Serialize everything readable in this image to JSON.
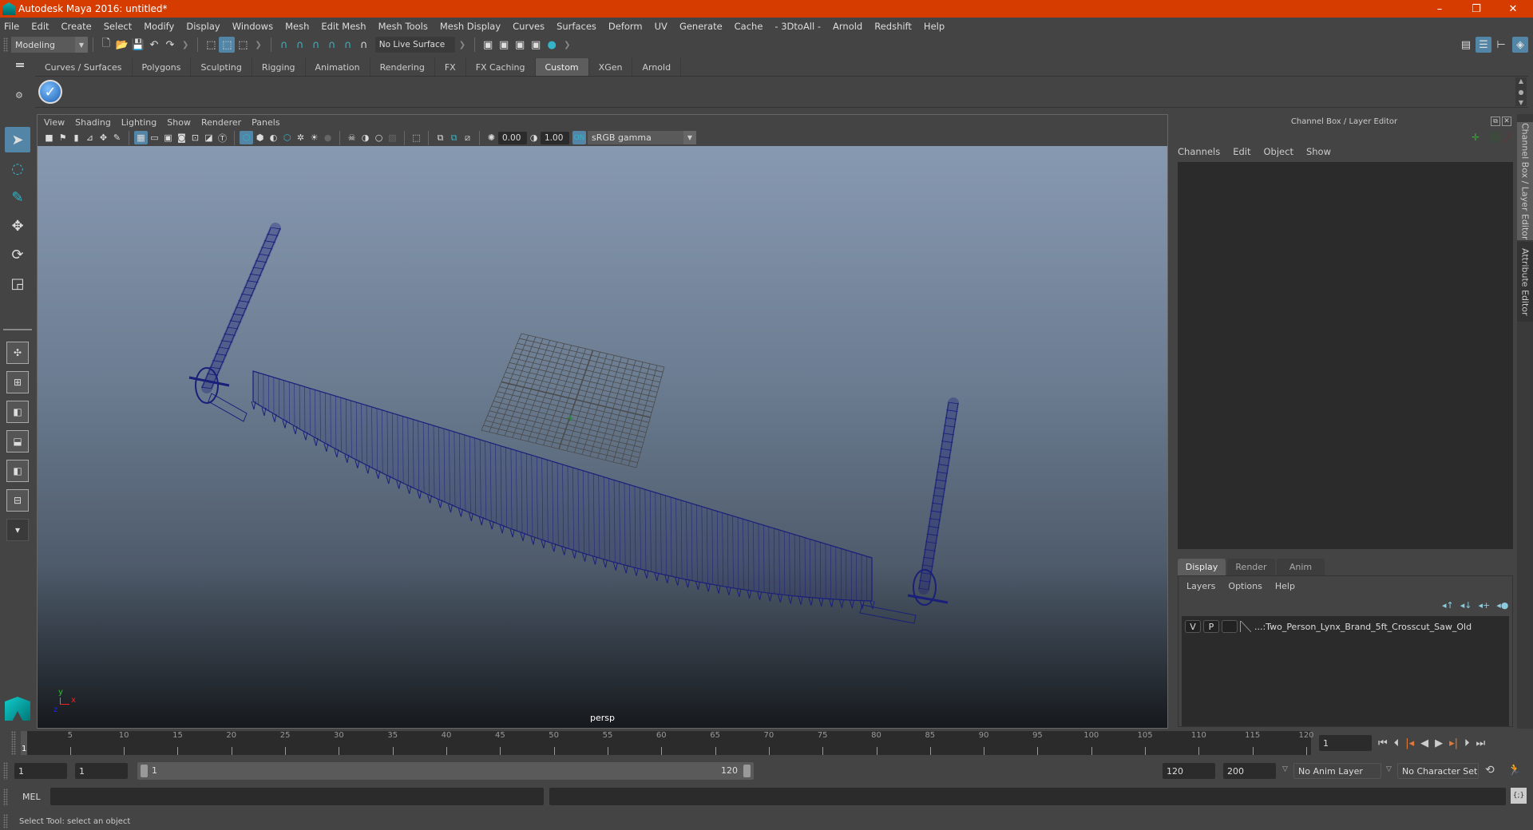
{
  "window": {
    "title": "Autodesk Maya 2016: untitled*",
    "minimize": "–",
    "restore": "❐",
    "close": "✕"
  },
  "menubar": [
    "File",
    "Edit",
    "Create",
    "Select",
    "Modify",
    "Display",
    "Windows",
    "Mesh",
    "Edit Mesh",
    "Mesh Tools",
    "Mesh Display",
    "Curves",
    "Surfaces",
    "Deform",
    "UV",
    "Generate",
    "Cache",
    "- 3DtoAll -",
    "Arnold",
    "Redshift",
    "Help"
  ],
  "statusline": {
    "mode": "Modeling",
    "live_surface": "No Live Surface"
  },
  "shelf": {
    "tabs": [
      "Curves / Surfaces",
      "Polygons",
      "Sculpting",
      "Rigging",
      "Animation",
      "Rendering",
      "FX",
      "FX Caching",
      "Custom",
      "XGen",
      "Arnold"
    ],
    "active_tab": "Custom"
  },
  "viewport": {
    "menu": [
      "View",
      "Shading",
      "Lighting",
      "Show",
      "Renderer",
      "Panels"
    ],
    "exposure": "0.00",
    "gamma": "1.00",
    "colorspace": "sRGB gamma",
    "camera_label": "persp",
    "axis": {
      "x": "x",
      "y": "y",
      "z": "z"
    }
  },
  "channel_box": {
    "title": "Channel Box / Layer Editor",
    "menu": [
      "Channels",
      "Edit",
      "Object",
      "Show"
    ]
  },
  "layer_editor": {
    "tabs": [
      "Display",
      "Render",
      "Anim"
    ],
    "active_tab": "Display",
    "menu": [
      "Layers",
      "Options",
      "Help"
    ],
    "layers": [
      {
        "v": "V",
        "p": "P",
        "name": "...:Two_Person_Lynx_Brand_5ft_Crosscut_Saw_Old"
      }
    ]
  },
  "side_tabs": [
    "Channel Box / Layer Editor",
    "Attribute Editor"
  ],
  "timeline": {
    "ticks": [
      5,
      10,
      15,
      20,
      25,
      30,
      35,
      40,
      45,
      50,
      55,
      60,
      65,
      70,
      75,
      80,
      85,
      90,
      95,
      100,
      105,
      110,
      115,
      120
    ],
    "current_frame": "1",
    "current_frame_field": "1",
    "min": 1,
    "max": 120
  },
  "range": {
    "start": "1",
    "playback_start": "1",
    "range_start_label": "1",
    "range_end_label": "120",
    "playback_end": "120",
    "end": "200",
    "anim_layer": "No Anim Layer",
    "character_set": "No Character Set"
  },
  "command_line": {
    "label": "MEL",
    "value": ""
  },
  "help_line": "Select Tool: select an object",
  "colors": {
    "title_bar": "#d63c00",
    "accent": "#5285a6",
    "wireframe": "#1a1f7a"
  }
}
